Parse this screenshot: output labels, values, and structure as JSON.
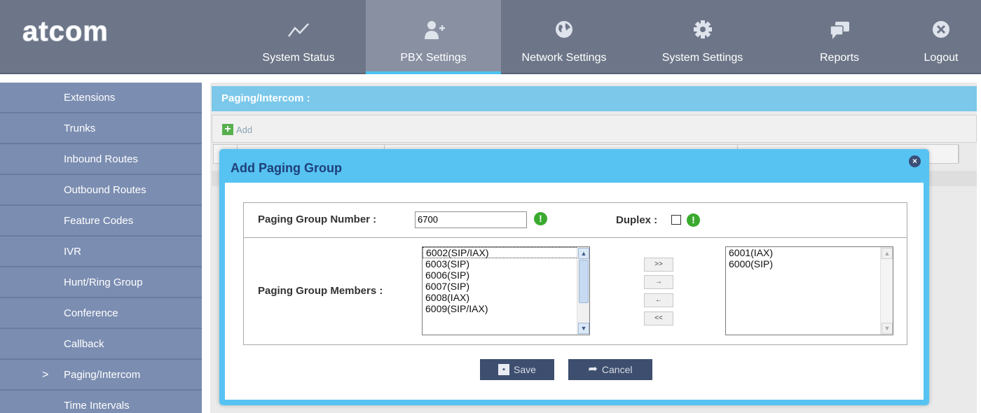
{
  "brand": {
    "logo_text": "atcom",
    "logo_color": "#ffffff"
  },
  "nav": {
    "items": [
      {
        "label": "System Status",
        "icon": "trend-line-icon"
      },
      {
        "label": "PBX Settings",
        "icon": "user-add-icon",
        "active": true
      },
      {
        "label": "Network Settings",
        "icon": "globe-icon"
      },
      {
        "label": "System Settings",
        "icon": "gear-icon"
      },
      {
        "label": "Reports",
        "icon": "chat-bubble-icon"
      },
      {
        "label": "Logout",
        "icon": "close-circle-icon"
      }
    ]
  },
  "sidebar": {
    "items": [
      {
        "label": "Extensions"
      },
      {
        "label": "Trunks"
      },
      {
        "label": "Inbound Routes"
      },
      {
        "label": "Outbound Routes"
      },
      {
        "label": "Feature Codes"
      },
      {
        "label": "IVR"
      },
      {
        "label": "Hunt/Ring Group"
      },
      {
        "label": "Conference"
      },
      {
        "label": "Callback"
      },
      {
        "label": "Paging/Intercom",
        "active": true
      },
      {
        "label": "Time Intervals"
      }
    ],
    "active_marker": ">"
  },
  "main": {
    "section_title": "Paging/Intercom :",
    "add_label": "Add",
    "add_symbol": "+"
  },
  "dialog": {
    "title": "Add Paging Group",
    "close_symbol": "×",
    "group_number_label": "Paging Group Number :",
    "group_number_value": "6700",
    "duplex_label": "Duplex :",
    "duplex_checked": false,
    "members_label": "Paging Group Members :",
    "info_symbol": "!",
    "available_members": [
      "6002(SIP/IAX)",
      "6003(SIP)",
      "6006(SIP)",
      "6007(SIP)",
      "6008(IAX)",
      "6009(SIP/IAX)"
    ],
    "selected_members": [
      "6001(IAX)",
      "6000(SIP)"
    ],
    "move_buttons": {
      "all_right": ">>",
      "right": "→",
      "left": "←",
      "all_left": "<<"
    },
    "save_label": "Save",
    "cancel_label": "Cancel"
  },
  "colors": {
    "topbar": "#6d7688",
    "nav_active_underline": "#4cc3f1",
    "sidebar": "#7b8db1",
    "section_title": "#7cc8ea",
    "dialog_frame": "#56c3f2",
    "info_green": "#3aaa2f",
    "button_dark": "#3e4e6e"
  }
}
